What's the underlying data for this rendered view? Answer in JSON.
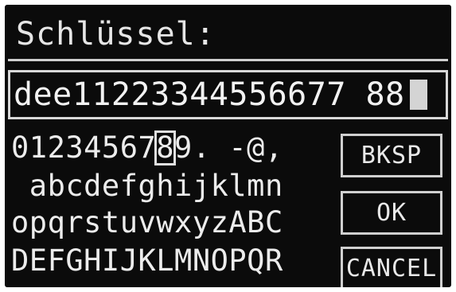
{
  "title": {
    "label": "Schlüssel:"
  },
  "entry": {
    "value": "dee11223344556677 88"
  },
  "keyboard": {
    "selected_key": "8",
    "rows": [
      [
        "0",
        "1",
        "2",
        "3",
        "4",
        "5",
        "6",
        "7",
        "8",
        "9",
        ".",
        " ",
        "-",
        "@",
        ","
      ],
      [
        " ",
        "a",
        "b",
        "c",
        "d",
        "e",
        "f",
        "g",
        "h",
        "i",
        "j",
        "k",
        "l",
        "m",
        "n"
      ],
      [
        "o",
        "p",
        "q",
        "r",
        "s",
        "t",
        "u",
        "v",
        "w",
        "x",
        "y",
        "z",
        "A",
        "B",
        "C"
      ],
      [
        "D",
        "E",
        "F",
        "G",
        "H",
        "I",
        "J",
        "K",
        "L",
        "M",
        "N",
        "O",
        "P",
        "Q",
        "R"
      ]
    ]
  },
  "buttons": {
    "backspace": "BKSP",
    "ok": "OK",
    "cancel": "CANCEL"
  }
}
